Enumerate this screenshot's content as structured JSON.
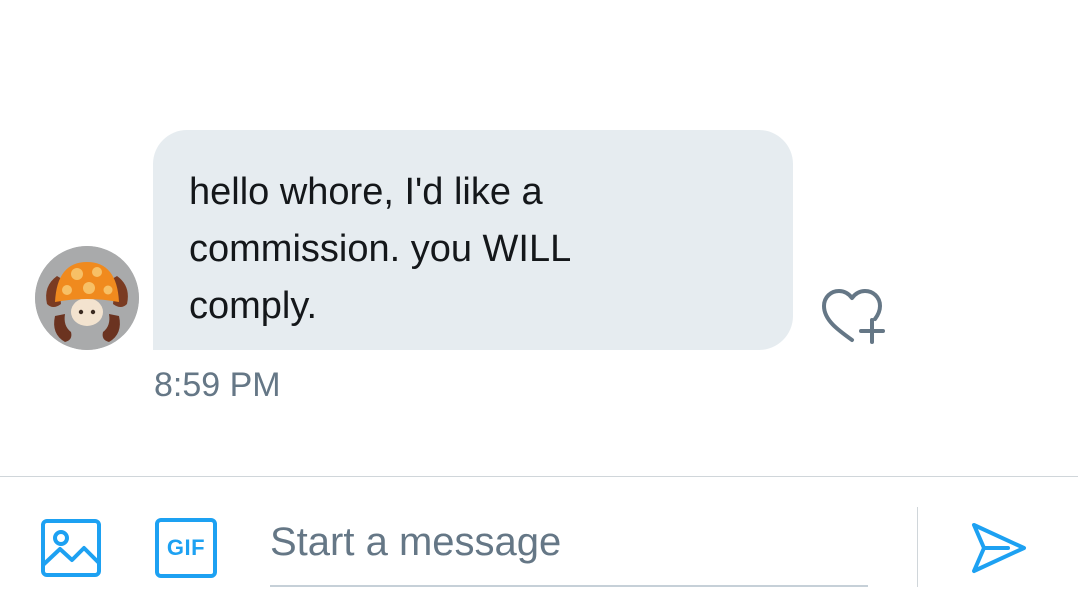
{
  "conversation": {
    "message": {
      "text": "hello whore, I'd like a\ncommission. you WILL\ncomply.",
      "timestamp": "8:59 PM"
    },
    "avatar_icon": "mushroom-character-icon"
  },
  "composer": {
    "placeholder": "Start a message",
    "gif_label": "GIF",
    "media_icon": "image-icon",
    "send_icon": "send-icon",
    "react_icon": "heart-plus-icon"
  },
  "colors": {
    "accent": "#1da1f2",
    "bubble": "#e6ecf0",
    "secondary_text": "#657786",
    "primary_text": "#14171a"
  }
}
